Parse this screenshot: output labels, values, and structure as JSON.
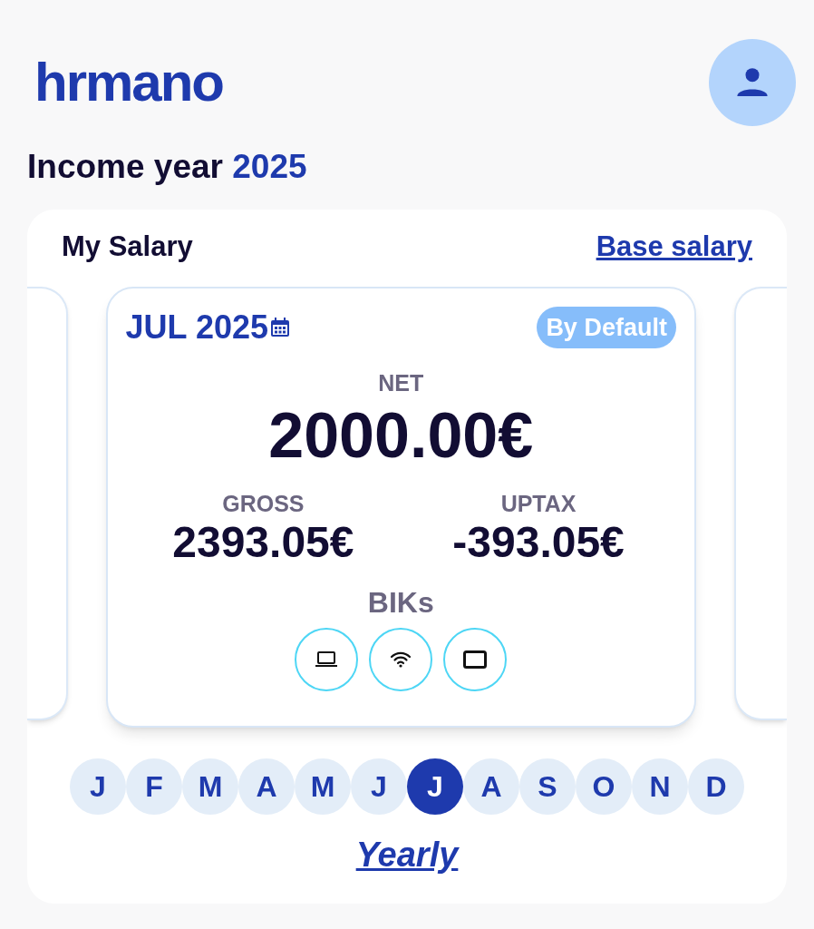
{
  "logo": "hrmano",
  "title": {
    "prefix": "Income year",
    "year": "2025"
  },
  "salary": {
    "heading": "My Salary",
    "link": "Base salary",
    "card": {
      "month": "JUL 2025",
      "badge": "By Default",
      "net_label": "NET",
      "net": "2000.00€",
      "gross_label": "GROSS",
      "gross": "2393.05€",
      "uptax_label": "UPTAX",
      "uptax": "-393.05€",
      "biks_label": "BIKs",
      "biks": [
        {
          "kind": "laptop"
        },
        {
          "kind": "wifi"
        },
        {
          "kind": "tablet"
        }
      ]
    }
  },
  "months": [
    {
      "label": "J",
      "selected": false
    },
    {
      "label": "F",
      "selected": false
    },
    {
      "label": "M",
      "selected": false
    },
    {
      "label": "A",
      "selected": false
    },
    {
      "label": "M",
      "selected": false
    },
    {
      "label": "J",
      "selected": false
    },
    {
      "label": "J",
      "selected": true
    },
    {
      "label": "A",
      "selected": false
    },
    {
      "label": "S",
      "selected": false
    },
    {
      "label": "O",
      "selected": false
    },
    {
      "label": "N",
      "selected": false
    },
    {
      "label": "D",
      "selected": false
    }
  ],
  "yearly": "Yearly"
}
